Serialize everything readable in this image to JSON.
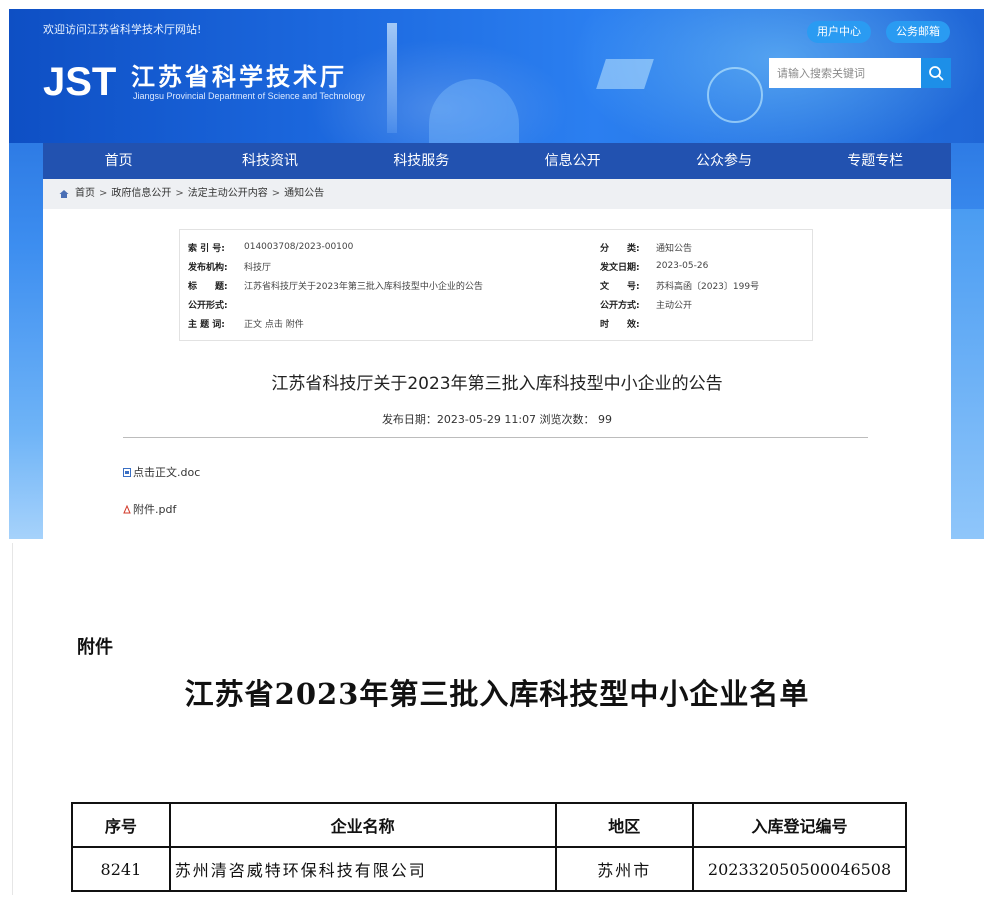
{
  "header": {
    "welcome": "欢迎访问江苏省科学技术厅网站!",
    "user_center": "用户中心",
    "mail": "公务邮箱",
    "logo_mark": "JST",
    "logo_cn": "江苏省科学技术厅",
    "logo_en": "Jiangsu Provincial Department of Science and Technology",
    "search_placeholder": "请输入搜索关键词"
  },
  "nav": [
    "首页",
    "科技资讯",
    "科技服务",
    "信息公开",
    "公众参与",
    "专题专栏"
  ],
  "breadcrumb": [
    "首页",
    "政府信息公开",
    "法定主动公开内容",
    "通知公告"
  ],
  "meta": {
    "index_label": "索 引 号:",
    "index_value": "014003708/2023-00100",
    "category_label": "分　　类:",
    "category_value": "通知公告",
    "publisher_label": "发布机构:",
    "publisher_value": "科技厅",
    "date_label": "发文日期:",
    "date_value": "2023-05-26",
    "title_label": "标　　题:",
    "title_value": "江苏省科技厅关于2023年第三批入库科技型中小企业的公告",
    "docno_label": "文　　号:",
    "docno_value": "苏科高函〔2023〕199号",
    "public_form_label": "公开形式:",
    "public_form_value": "",
    "public_mode_label": "公开方式:",
    "public_mode_value": "主动公开",
    "keyword_label": "主 题 词:",
    "keyword_value": "正文 点击 附件",
    "validity_label": "时　　效:",
    "validity_value": ""
  },
  "article": {
    "title": "江苏省科技厅关于2023年第三批入库科技型中小企业的公告",
    "publish_info": "发布日期：2023-05-29 11:07   浏览次数：  99",
    "attachment_doc": "点击正文.doc",
    "attachment_pdf": "附件.pdf"
  },
  "document": {
    "annex_label": "附件",
    "title": "江苏省2023年第三批入库科技型中小企业名单",
    "table": {
      "headers": [
        "序号",
        "企业名称",
        "地区",
        "入库登记编号"
      ],
      "rows": [
        [
          "8241",
          "苏州清咨威特环保科技有限公司",
          "苏州市",
          "202332050500046508"
        ]
      ]
    }
  },
  "colors": {
    "nav_bg": "#2252b0",
    "banner_blue": "#1d6ae0",
    "button_blue": "#2a9bf2"
  }
}
